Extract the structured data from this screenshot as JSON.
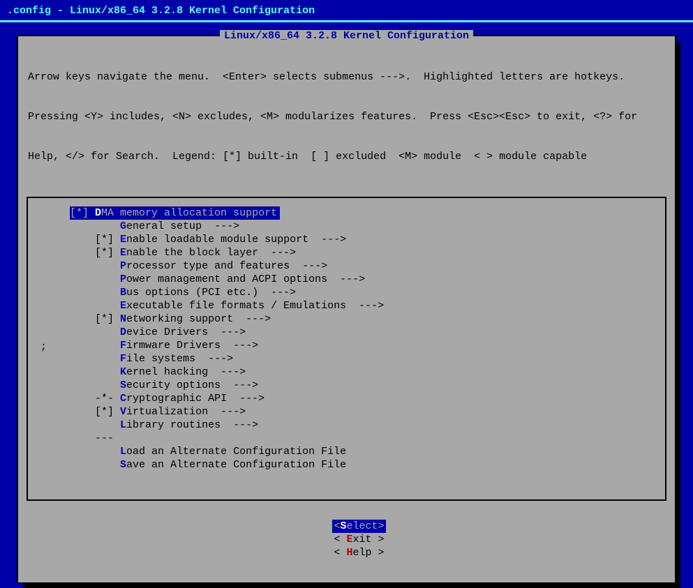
{
  "title": ".config - Linux/x86_64 3.2.8 Kernel Configuration",
  "panel_title": "Linux/x86_64 3.2.8 Kernel Configuration",
  "help_line1": "Arrow keys navigate the menu.  <Enter> selects submenus --->.  Highlighted letters are hotkeys.",
  "help_line2": "Pressing <Y> includes, <N> excludes, <M> modularizes features.  Press <Esc><Esc> to exit, <?> for",
  "help_line3": "Help, </> for Search.  Legend: [*] built-in  [ ] excluded  <M> module  < > module capable",
  "stray_char": ";",
  "menu": [
    {
      "state": "[*]",
      "hotkey": "D",
      "rest": "MA memory allocation support",
      "arrow": "",
      "selected": true
    },
    {
      "state": "   ",
      "hotkey": "G",
      "rest": "eneral setup  --->",
      "arrow": ""
    },
    {
      "state": "[*]",
      "hotkey": "E",
      "rest": "nable loadable module support  --->",
      "arrow": ""
    },
    {
      "state": "[*]",
      "hotkey": "E",
      "rest": "nable the block layer  --->",
      "arrow": ""
    },
    {
      "state": "   ",
      "hotkey": "P",
      "rest": "rocessor type and features  --->",
      "arrow": ""
    },
    {
      "state": "   ",
      "hotkey": "P",
      "rest": "ower management and ACPI options  --->",
      "arrow": ""
    },
    {
      "state": "   ",
      "hotkey": "B",
      "rest": "us options (PCI etc.)  --->",
      "arrow": ""
    },
    {
      "state": "   ",
      "hotkey": "E",
      "rest": "xecutable file formats / Emulations  --->",
      "arrow": ""
    },
    {
      "state": "[*]",
      "hotkey": "N",
      "rest": "etworking support  --->",
      "arrow": ""
    },
    {
      "state": "   ",
      "hotkey": "D",
      "rest": "evice Drivers  --->",
      "arrow": ""
    },
    {
      "state": "   ",
      "hotkey": "F",
      "rest": "irmware Drivers  --->",
      "arrow": ""
    },
    {
      "state": "   ",
      "hotkey": "F",
      "rest": "ile systems  --->",
      "arrow": ""
    },
    {
      "state": "   ",
      "hotkey": "K",
      "rest": "ernel hacking  --->",
      "arrow": ""
    },
    {
      "state": "   ",
      "hotkey": "S",
      "rest": "ecurity options  --->",
      "arrow": ""
    },
    {
      "state": "-*-",
      "hotkey": "C",
      "rest": "ryptographic API  --->",
      "arrow": ""
    },
    {
      "state": "[*]",
      "hotkey": "V",
      "rest": "irtualization  --->",
      "arrow": ""
    },
    {
      "state": "   ",
      "hotkey": "L",
      "rest": "ibrary routines  --->",
      "arrow": ""
    },
    {
      "state": "---",
      "hotkey": "",
      "rest": "",
      "arrow": ""
    },
    {
      "state": "   ",
      "hotkey": "L",
      "rest": "oad an Alternate Configuration File",
      "arrow": ""
    },
    {
      "state": "   ",
      "hotkey": "S",
      "rest": "ave an Alternate Configuration File",
      "arrow": ""
    }
  ],
  "buttons": {
    "select": {
      "open": "<",
      "hot": "S",
      "rest": "elect",
      "close": ">",
      "selected": true
    },
    "exit": {
      "open": "< ",
      "hot": "E",
      "rest": "xit ",
      "close": ">",
      "selected": false
    },
    "help": {
      "open": "< ",
      "hot": "H",
      "rest": "elp ",
      "close": ">",
      "selected": false
    }
  }
}
